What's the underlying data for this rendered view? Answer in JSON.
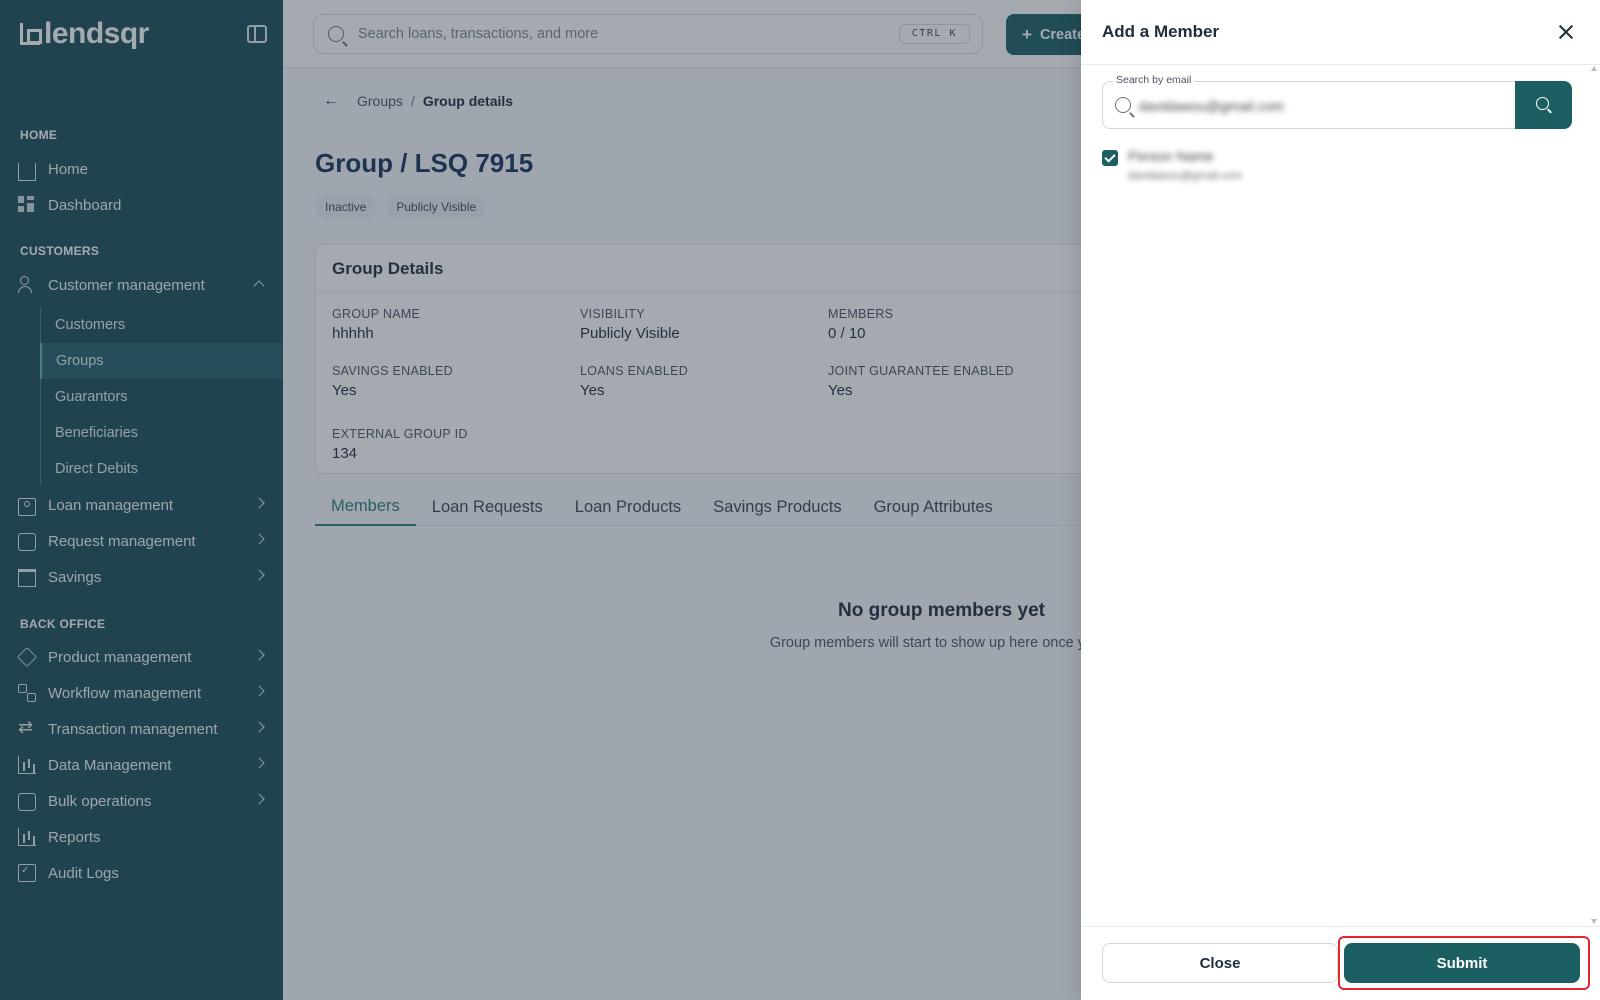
{
  "brand": {
    "name": "lendsqr"
  },
  "sidebar": {
    "sections": {
      "home": "HOME",
      "customers": "CUSTOMERS",
      "back_office": "BACK OFFICE"
    },
    "items": {
      "home": "Home",
      "dashboard": "Dashboard",
      "customer_management": "Customer management",
      "loan_management": "Loan management",
      "request_management": "Request management",
      "savings": "Savings",
      "product_management": "Product management",
      "workflow_management": "Workflow management",
      "transaction_management": "Transaction management",
      "data_management": "Data Management",
      "bulk_operations": "Bulk operations",
      "reports": "Reports",
      "audit_logs": "Audit Logs"
    },
    "customer_sub": [
      "Customers",
      "Groups",
      "Guarantors",
      "Beneficiaries",
      "Direct Debits"
    ],
    "active_sub": "Groups"
  },
  "topbar": {
    "search_placeholder": "Search loans, transactions, and more",
    "shortcut": "CTRL K",
    "create_label": "Create"
  },
  "breadcrumb": {
    "parent": "Groups",
    "separator": "/",
    "current": "Group details"
  },
  "page": {
    "title": "Group / LSQ 7915",
    "badges": [
      "Inactive",
      "Publicly Visible"
    ]
  },
  "group_details": {
    "heading": "Group Details",
    "fields": {
      "group_name": {
        "label": "GROUP NAME",
        "value": "hhhhh"
      },
      "visibility": {
        "label": "VISIBILITY",
        "value": "Publicly Visible"
      },
      "members": {
        "label": "MEMBERS",
        "value": "0 / 10"
      },
      "savings_enabled": {
        "label": "SAVINGS ENABLED",
        "value": "Yes"
      },
      "loans_enabled": {
        "label": "LOANS ENABLED",
        "value": "Yes"
      },
      "joint_guarantee": {
        "label": "JOINT GUARANTEE ENABLED",
        "value": "Yes"
      },
      "external_group_id": {
        "label": "EXTERNAL GROUP ID",
        "value": "134"
      }
    }
  },
  "tabs": [
    "Members",
    "Loan Requests",
    "Loan Products",
    "Savings Products",
    "Group Attributes"
  ],
  "active_tab": "Members",
  "empty_state": {
    "title": "No group members yet",
    "subtitle": "Group members will start to show up here once you a"
  },
  "drawer": {
    "title": "Add a Member",
    "search_label": "Search by email",
    "search_value": "davidawou@gmail.com",
    "result": {
      "checked": true,
      "name": "Person Name",
      "email": "davidawou@gmail.com"
    },
    "close_label": "Close",
    "submit_label": "Submit"
  },
  "colors": {
    "sidebar": "#1c4f57",
    "accent": "#1c5f62",
    "highlight": "#e5262f"
  }
}
